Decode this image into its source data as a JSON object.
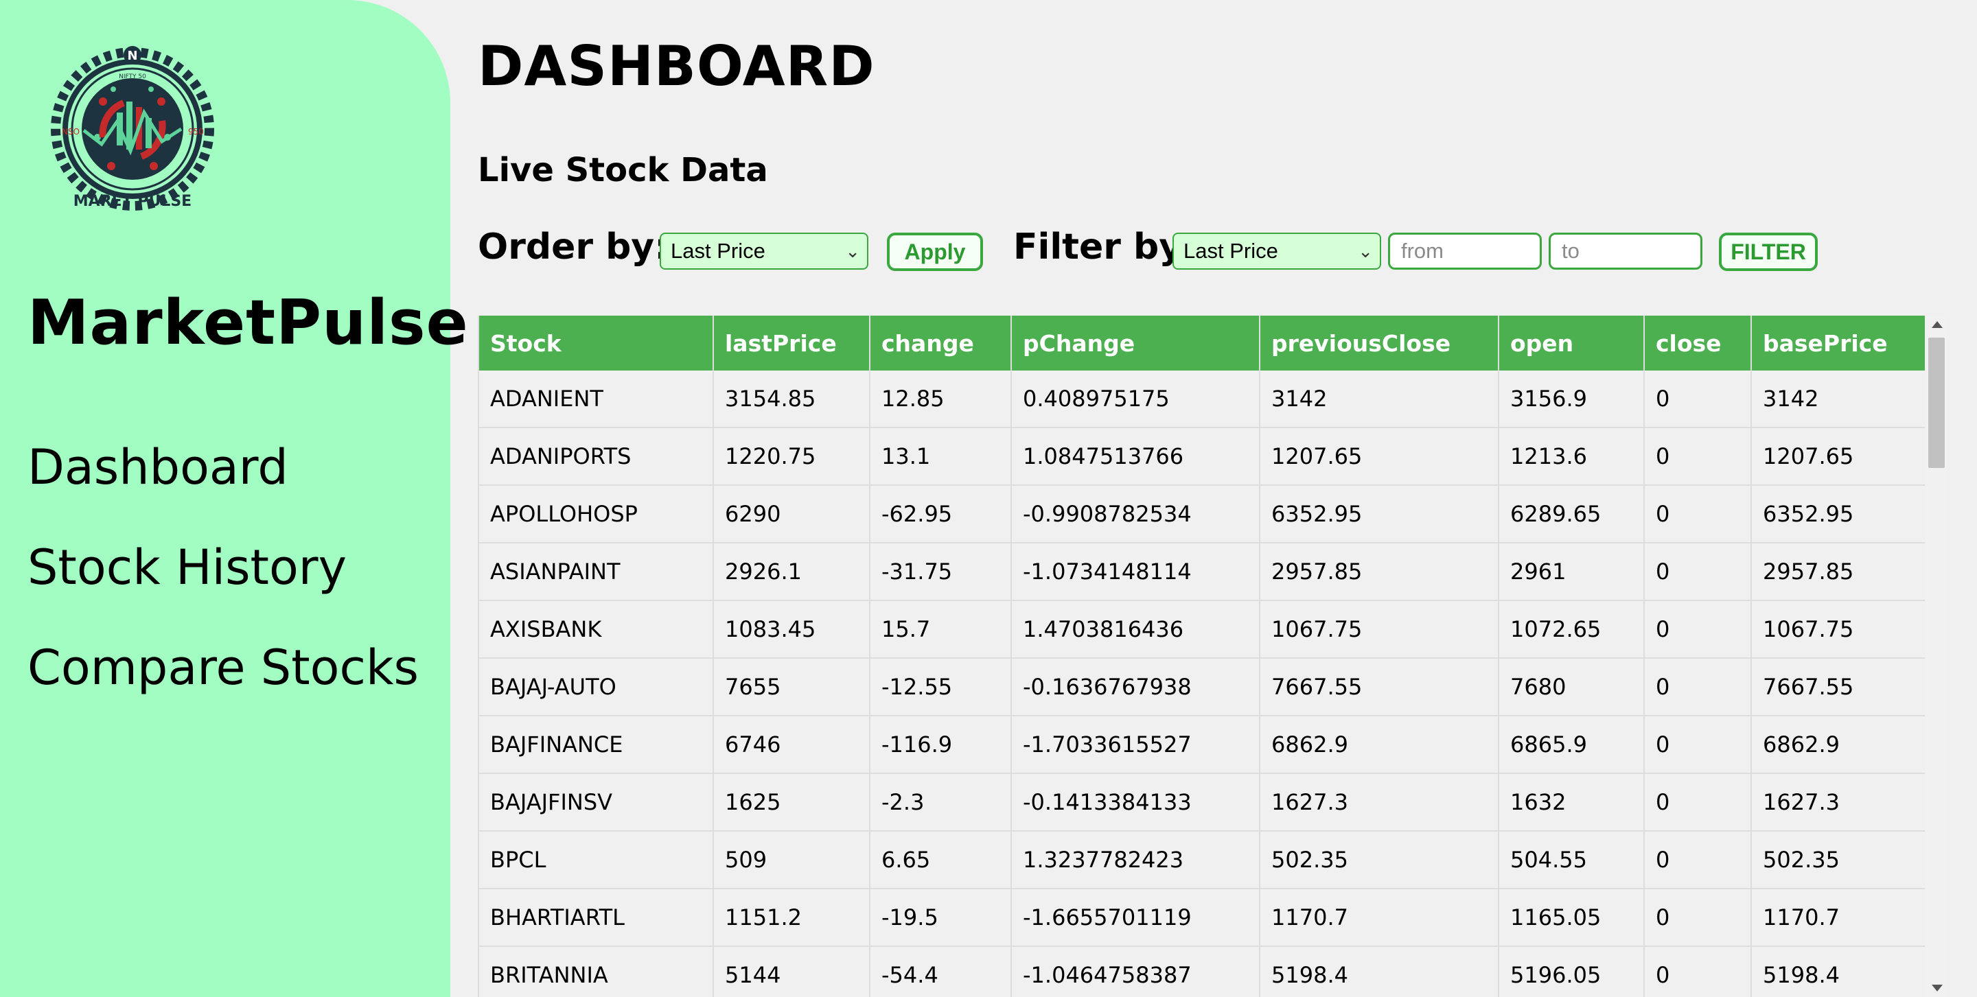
{
  "sidebar": {
    "logo": {
      "top_text": "NIFTY 50",
      "left_text": "NSO",
      "right_text": "950",
      "bottom_text": "MARET PULSE"
    },
    "brand": "MarketPulse",
    "nav": [
      "Dashboard",
      "Stock History",
      "Compare Stocks"
    ]
  },
  "main": {
    "title": "DASHBOARD",
    "section_title": "Live Stock Data",
    "order_by": {
      "label": "Order by:",
      "selected": "Last Price",
      "button": "Apply"
    },
    "filter_by": {
      "label": "Filter by:",
      "selected": "Last Price",
      "from_placeholder": "from",
      "to_placeholder": "to",
      "button": "FILTER"
    }
  },
  "table": {
    "headers": [
      "Stock",
      "lastPrice",
      "change",
      "pChange",
      "previousClose",
      "open",
      "close",
      "basePrice"
    ],
    "rows": [
      [
        "ADANIENT",
        "3154.85",
        "12.85",
        "0.408975175",
        "3142",
        "3156.9",
        "0",
        "3142"
      ],
      [
        "ADANIPORTS",
        "1220.75",
        "13.1",
        "1.0847513766",
        "1207.65",
        "1213.6",
        "0",
        "1207.65"
      ],
      [
        "APOLLOHOSP",
        "6290",
        "-62.95",
        "-0.9908782534",
        "6352.95",
        "6289.65",
        "0",
        "6352.95"
      ],
      [
        "ASIANPAINT",
        "2926.1",
        "-31.75",
        "-1.0734148114",
        "2957.85",
        "2961",
        "0",
        "2957.85"
      ],
      [
        "AXISBANK",
        "1083.45",
        "15.7",
        "1.4703816436",
        "1067.75",
        "1072.65",
        "0",
        "1067.75"
      ],
      [
        "BAJAJ-AUTO",
        "7655",
        "-12.55",
        "-0.1636767938",
        "7667.55",
        "7680",
        "0",
        "7667.55"
      ],
      [
        "BAJFINANCE",
        "6746",
        "-116.9",
        "-1.7033615527",
        "6862.9",
        "6865.9",
        "0",
        "6862.9"
      ],
      [
        "BAJAJFINSV",
        "1625",
        "-2.3",
        "-0.1413384133",
        "1627.3",
        "1632",
        "0",
        "1627.3"
      ],
      [
        "BPCL",
        "509",
        "6.65",
        "1.3237782423",
        "502.35",
        "504.55",
        "0",
        "502.35"
      ],
      [
        "BHARTIARTL",
        "1151.2",
        "-19.5",
        "-1.6655701119",
        "1170.7",
        "1165.05",
        "0",
        "1170.7"
      ],
      [
        "BRITANNIA",
        "5144",
        "-54.4",
        "-1.0464758387",
        "5198.4",
        "5196.05",
        "0",
        "5198.4"
      ]
    ]
  },
  "colors": {
    "sidebar_bg": "#a2fdc2",
    "header_bg": "#4caf50",
    "accent": "#3aa83f",
    "logo_dark": "#1d3440",
    "logo_red": "#c62b2b",
    "logo_green": "#5ed39a"
  }
}
